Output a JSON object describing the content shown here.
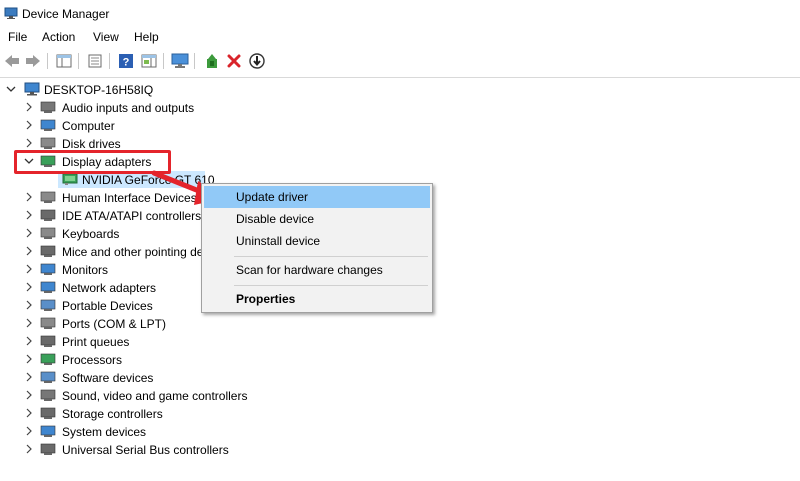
{
  "window": {
    "title": "Device Manager"
  },
  "menu": [
    "File",
    "Action",
    "View",
    "Help"
  ],
  "toolbar": {
    "buttons": [
      "back-icon",
      "forward-icon",
      "show-hide-console-tree-icon",
      "properties-icon",
      "help-icon",
      "action-pane-icon",
      "monitor-icon",
      "update-driver-icon",
      "uninstall-icon",
      "enable-device-icon"
    ]
  },
  "tree": {
    "root": "DESKTOP-16H58IQ",
    "categories": [
      "Audio inputs and outputs",
      "Computer",
      "Disk drives",
      "Display adapters",
      "Human Interface Devices",
      "IDE ATA/ATAPI controllers",
      "Keyboards",
      "Mice and other pointing devices",
      "Monitors",
      "Network adapters",
      "Portable Devices",
      "Ports (COM & LPT)",
      "Print queues",
      "Processors",
      "Software devices",
      "Sound, video and game controllers",
      "Storage controllers",
      "System devices",
      "Universal Serial Bus controllers"
    ],
    "expanded_child": "NVIDIA GeForce GT 610"
  },
  "context_menu": {
    "items": [
      "Update driver",
      "Disable device",
      "Uninstall device",
      "Scan for hardware changes",
      "Properties"
    ]
  },
  "colors": {
    "highlight_box": "#e4242b",
    "arrow": "#e4242b",
    "selection": "#cce8ff",
    "menu_hover": "#91c9f7"
  }
}
